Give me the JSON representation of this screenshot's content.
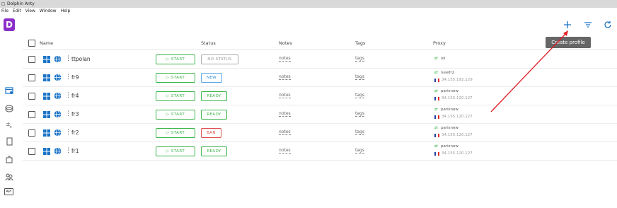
{
  "window": {
    "title": "Dolphin Anty"
  },
  "menu": [
    "File",
    "Edit",
    "View",
    "Window",
    "Help"
  ],
  "logo": {
    "letter": "D",
    "color": "#8b2fc9"
  },
  "sidebar": {
    "icons": [
      "profiles-icon",
      "cookies-icon",
      "automation-icon",
      "bookmark-icon",
      "extensions-icon",
      "team-icon"
    ],
    "api_label": "API"
  },
  "toolbar": {
    "add_icon": "plus-icon",
    "filter_icon": "filter-icon",
    "refresh_icon": "refresh-icon",
    "tooltip": "Create profile"
  },
  "table": {
    "headers": {
      "name": "Name",
      "status": "Status",
      "notes": "Notes",
      "tags": "Tags",
      "proxy": "Proxy"
    },
    "rows": [
      {
        "name": "ttpolan",
        "start": "START",
        "status": "NO STATUS",
        "status_type": "none",
        "notes": "notes",
        "tags": "tags",
        "proxy_name": "lol",
        "proxy_ip": ""
      },
      {
        "name": "fr9",
        "start": "START",
        "status": "NEW",
        "status_type": "new",
        "notes": "notes",
        "tags": "tags",
        "proxy_name": "newfr2",
        "proxy_ip": "34.155.192.129"
      },
      {
        "name": "fr4",
        "start": "START",
        "status": "READY",
        "status_type": "ready",
        "notes": "notes",
        "tags": "tags",
        "proxy_name": "parisnew",
        "proxy_ip": "34.155.120.127"
      },
      {
        "name": "fr3",
        "start": "START",
        "status": "READY",
        "status_type": "ready",
        "notes": "notes",
        "tags": "tags",
        "proxy_name": "parisnew",
        "proxy_ip": "34.155.120.127"
      },
      {
        "name": "fr2",
        "start": "START",
        "status": "BAN",
        "status_type": "ban",
        "notes": "notes",
        "tags": "tags",
        "proxy_name": "parisnew",
        "proxy_ip": "34.155.120.127"
      },
      {
        "name": "fr1",
        "start": "START",
        "status": "READY",
        "status_type": "ready",
        "notes": "notes",
        "tags": "tags",
        "proxy_name": "parisnew",
        "proxy_ip": "34.155.120.127"
      }
    ]
  },
  "colors": {
    "accent": "#1a73c7",
    "start": "#3bb54a",
    "ban": "#e24c4c",
    "new": "#2f8ad8",
    "annotation_arrow": "#e01b24"
  }
}
